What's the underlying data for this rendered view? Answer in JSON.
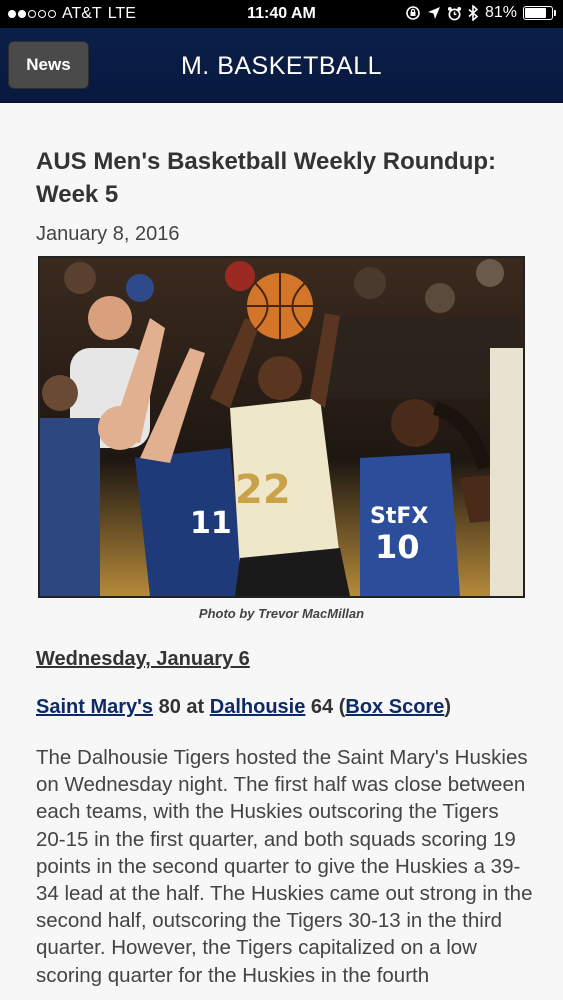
{
  "status_bar": {
    "carrier": "AT&T",
    "network": "LTE",
    "time": "11:40 AM",
    "battery_percent": "81%",
    "battery_level": 0.81,
    "signal_bars_filled": 2,
    "signal_bars_total": 5,
    "icons": [
      "rotation-lock-icon",
      "location-arrow-icon",
      "alarm-icon",
      "bluetooth-icon",
      "battery-icon"
    ]
  },
  "nav": {
    "back_label": "News",
    "title": "M. BASKETBALL"
  },
  "article": {
    "title": "AUS Men's Basketball Weekly Roundup: Week 5",
    "date": "January 8, 2016",
    "photo_caption": "Photo by Trevor MacMillan",
    "day_heading": "Wednesday, January 6",
    "game": {
      "away_team": "Saint Mary's",
      "away_score": "80",
      "at": "at",
      "home_team": "Dalhousie",
      "home_score": "64",
      "box_score_label": "Box Score"
    },
    "body": "The Dalhousie Tigers hosted the Saint Mary's Huskies on Wednesday night. The first half was close between each teams, with the Huskies outscoring the Tigers 20-15 in the first quarter, and both squads scoring 19 points in the second quarter to give the Huskies a 39-34 lead at the half. The Huskies came out strong in the second half, outscoring the Tigers 30-13 in the third quarter. However, the Tigers capitalized on a low scoring quarter for the Huskies in the fourth"
  },
  "colors": {
    "nav_background": "#0b1f4a",
    "link": "#0e2a66",
    "page_background": "#f7f7f7"
  }
}
